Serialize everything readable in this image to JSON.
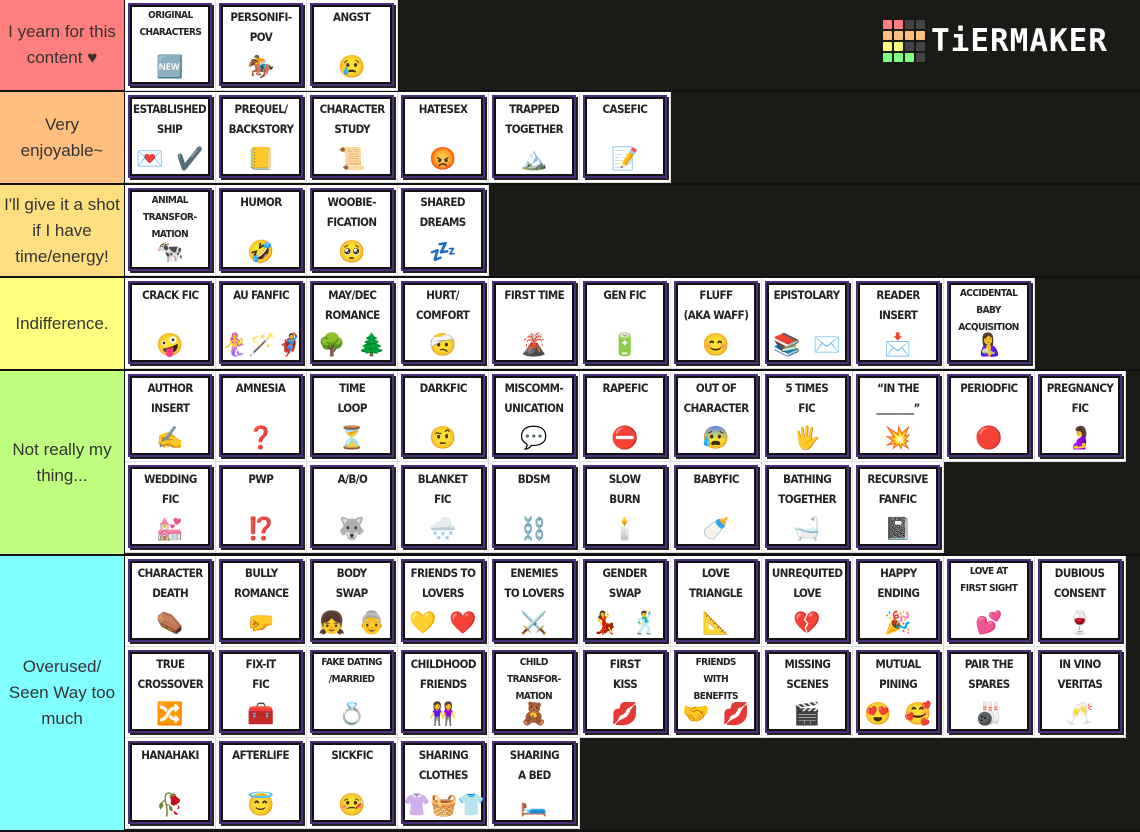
{
  "logo": {
    "text": "TiERMAKER",
    "grid_colors": [
      "#ff7f7f",
      "#ff7f7f",
      "#444",
      "#444",
      "#ffbf7f",
      "#ffbf7f",
      "#ffbf7f",
      "#ffbf7f",
      "#ffff7f",
      "#ffff7f",
      "#444",
      "#444",
      "#7fff7f",
      "#7fff7f",
      "#7fff7f",
      "#444"
    ]
  },
  "tiers": [
    {
      "label": "I yearn for this content ♥",
      "color": "#ff7f7f",
      "items": [
        {
          "title": "ORIGINAL\nCHARACTERS",
          "emoji": [
            "🆕"
          ]
        },
        {
          "title": "PERSONIFI-\nPOV",
          "emoji": [
            "🏇"
          ]
        },
        {
          "title": "ANGST",
          "emoji": [
            "😢"
          ]
        }
      ]
    },
    {
      "label": "Very enjoyable~",
      "color": "#ffbf7f",
      "items": [
        {
          "title": "ESTABLISHED\nSHIP",
          "emoji": [
            "💌",
            "✔️"
          ]
        },
        {
          "title": "PREQUEL/\nBACKSTORY",
          "emoji": [
            "📒"
          ]
        },
        {
          "title": "CHARACTER\nSTUDY",
          "emoji": [
            "📜"
          ]
        },
        {
          "title": "HATESEX",
          "emoji": [
            "😡"
          ]
        },
        {
          "title": "TRAPPED\nTOGETHER",
          "emoji": [
            "🏔️"
          ]
        },
        {
          "title": "CASEFIC",
          "emoji": [
            "📝"
          ]
        }
      ]
    },
    {
      "label": "I'll give it a shot if I have time/energy!",
      "color": "#ffdf7f",
      "items": [
        {
          "title": "ANIMAL\nTRANSFOR-\nMATION",
          "emoji": [
            "🐄"
          ]
        },
        {
          "title": "HUMOR",
          "emoji": [
            "🤣"
          ]
        },
        {
          "title": "WOOBIE-\nFICATION",
          "emoji": [
            "🥺"
          ]
        },
        {
          "title": "SHARED\nDREAMS",
          "emoji": [
            "💤"
          ]
        }
      ]
    },
    {
      "label": "Indifference.",
      "color": "#ffff7f",
      "items": [
        {
          "title": "CRACK FIC",
          "emoji": [
            "🤪"
          ]
        },
        {
          "title": "AU FANFIC",
          "emoji": [
            "🧜‍♀️",
            "🪄",
            "🦸"
          ]
        },
        {
          "title": "MAY/DEC\nROMANCE",
          "emoji": [
            "🌳",
            "🌲"
          ]
        },
        {
          "title": "HURT/\nCOMFORT",
          "emoji": [
            "🤕"
          ]
        },
        {
          "title": "FIRST TIME",
          "emoji": [
            "🌋"
          ]
        },
        {
          "title": "GEN FIC",
          "emoji": [
            "🔋"
          ]
        },
        {
          "title": "FLUFF\n(AKA WAFF)",
          "emoji": [
            "😊"
          ]
        },
        {
          "title": "EPISTOLARY",
          "emoji": [
            "📚",
            "✉️"
          ]
        },
        {
          "title": "READER\nINSERT",
          "emoji": [
            "📩"
          ]
        },
        {
          "title": "ACCIDENTAL\nBABY\nACQUISITION",
          "emoji": [
            "🤱"
          ]
        }
      ]
    },
    {
      "label": "Not really my thing...",
      "color": "#bfff7f",
      "items": [
        {
          "title": "AUTHOR\nINSERT",
          "emoji": [
            "✍️"
          ]
        },
        {
          "title": "AMNESIA",
          "emoji": [
            "❓"
          ]
        },
        {
          "title": "TIME\nLOOP",
          "emoji": [
            "⏳"
          ]
        },
        {
          "title": "DARKFIC",
          "emoji": [
            "🤨"
          ]
        },
        {
          "title": "MISCOMM-\nUNICATION",
          "emoji": [
            "💬"
          ]
        },
        {
          "title": "RAPEFIC",
          "emoji": [
            "⛔"
          ]
        },
        {
          "title": "OUT OF\nCHARACTER",
          "emoji": [
            "😰"
          ]
        },
        {
          "title": "5 TIMES\nFIC",
          "emoji": [
            "🖐️"
          ]
        },
        {
          "title": "“IN THE\n________”",
          "emoji": [
            "💥"
          ]
        },
        {
          "title": "PERIODFIC",
          "emoji": [
            "🔴"
          ]
        },
        {
          "title": "PREGNANCY\nFIC",
          "emoji": [
            "🤰"
          ]
        },
        {
          "title": "WEDDING\nFIC",
          "emoji": [
            "💒"
          ]
        },
        {
          "title": "PWP",
          "emoji": [
            "⁉️"
          ]
        },
        {
          "title": "A/B/O",
          "emoji": [
            "🐺"
          ]
        },
        {
          "title": "BLANKET\nFIC",
          "emoji": [
            "🌨️"
          ]
        },
        {
          "title": "BDSM",
          "emoji": [
            "⛓️"
          ]
        },
        {
          "title": "SLOW\nBURN",
          "emoji": [
            "🕯️"
          ]
        },
        {
          "title": "BABYFIC",
          "emoji": [
            "🍼"
          ]
        },
        {
          "title": "BATHING\nTOGETHER",
          "emoji": [
            "🛁"
          ]
        },
        {
          "title": "RECURSIVE\nFANFIC",
          "emoji": [
            "📓"
          ]
        }
      ]
    },
    {
      "label": "Overused/ Seen Way too much",
      "color": "#7fffff",
      "items": [
        {
          "title": "CHARACTER\nDEATH",
          "emoji": [
            "⚰️"
          ]
        },
        {
          "title": "BULLY\nROMANCE",
          "emoji": [
            "🤛"
          ]
        },
        {
          "title": "BODY\nSWAP",
          "emoji": [
            "👧",
            "👵"
          ]
        },
        {
          "title": "FRIENDS TO\nLOVERS",
          "emoji": [
            "💛",
            "❤️"
          ]
        },
        {
          "title": "ENEMIES\nTO LOVERS",
          "emoji": [
            "⚔️"
          ]
        },
        {
          "title": "GENDER\nSWAP",
          "emoji": [
            "💃",
            "🕺"
          ]
        },
        {
          "title": "LOVE\nTRIANGLE",
          "emoji": [
            "📐"
          ]
        },
        {
          "title": "UNREQUITED\nLOVE",
          "emoji": [
            "💔"
          ]
        },
        {
          "title": "HAPPY\nENDING",
          "emoji": [
            "🎉"
          ]
        },
        {
          "title": "LOVE AT\nFIRST SIGHT",
          "emoji": [
            "💕"
          ]
        },
        {
          "title": "DUBIOUS\nCONSENT",
          "emoji": [
            "🍷"
          ]
        },
        {
          "title": "TRUE\nCROSSOVER",
          "emoji": [
            "🔀"
          ]
        },
        {
          "title": "FIX-IT\nFIC",
          "emoji": [
            "🧰"
          ]
        },
        {
          "title": "FAKE DATING\n/MARRIED",
          "emoji": [
            "💍"
          ]
        },
        {
          "title": "CHILDHOOD\nFRIENDS",
          "emoji": [
            "👭"
          ]
        },
        {
          "title": "CHILD\nTRANSFOR-\nMATION",
          "emoji": [
            "🧸"
          ]
        },
        {
          "title": "FIRST\nKISS",
          "emoji": [
            "💋"
          ]
        },
        {
          "title": "FRIENDS\nWITH\nBENEFITS",
          "emoji": [
            "🤝",
            "💋"
          ]
        },
        {
          "title": "MISSING\nSCENES",
          "emoji": [
            "🎬"
          ]
        },
        {
          "title": "MUTUAL\nPINING",
          "emoji": [
            "😍",
            "🥰"
          ]
        },
        {
          "title": "PAIR THE\nSPARES",
          "emoji": [
            "🎳"
          ]
        },
        {
          "title": "IN VINO\nVERITAS",
          "emoji": [
            "🥂"
          ]
        },
        {
          "title": "HANAHAKI",
          "emoji": [
            "🥀"
          ]
        },
        {
          "title": "AFTERLIFE",
          "emoji": [
            "😇"
          ]
        },
        {
          "title": "SICKFIC",
          "emoji": [
            "🤒"
          ]
        },
        {
          "title": "SHARING\nCLOTHES",
          "emoji": [
            "👚",
            "🧺",
            "👕"
          ]
        },
        {
          "title": "SHARING\nA BED",
          "emoji": [
            "🛏️"
          ]
        }
      ]
    }
  ]
}
